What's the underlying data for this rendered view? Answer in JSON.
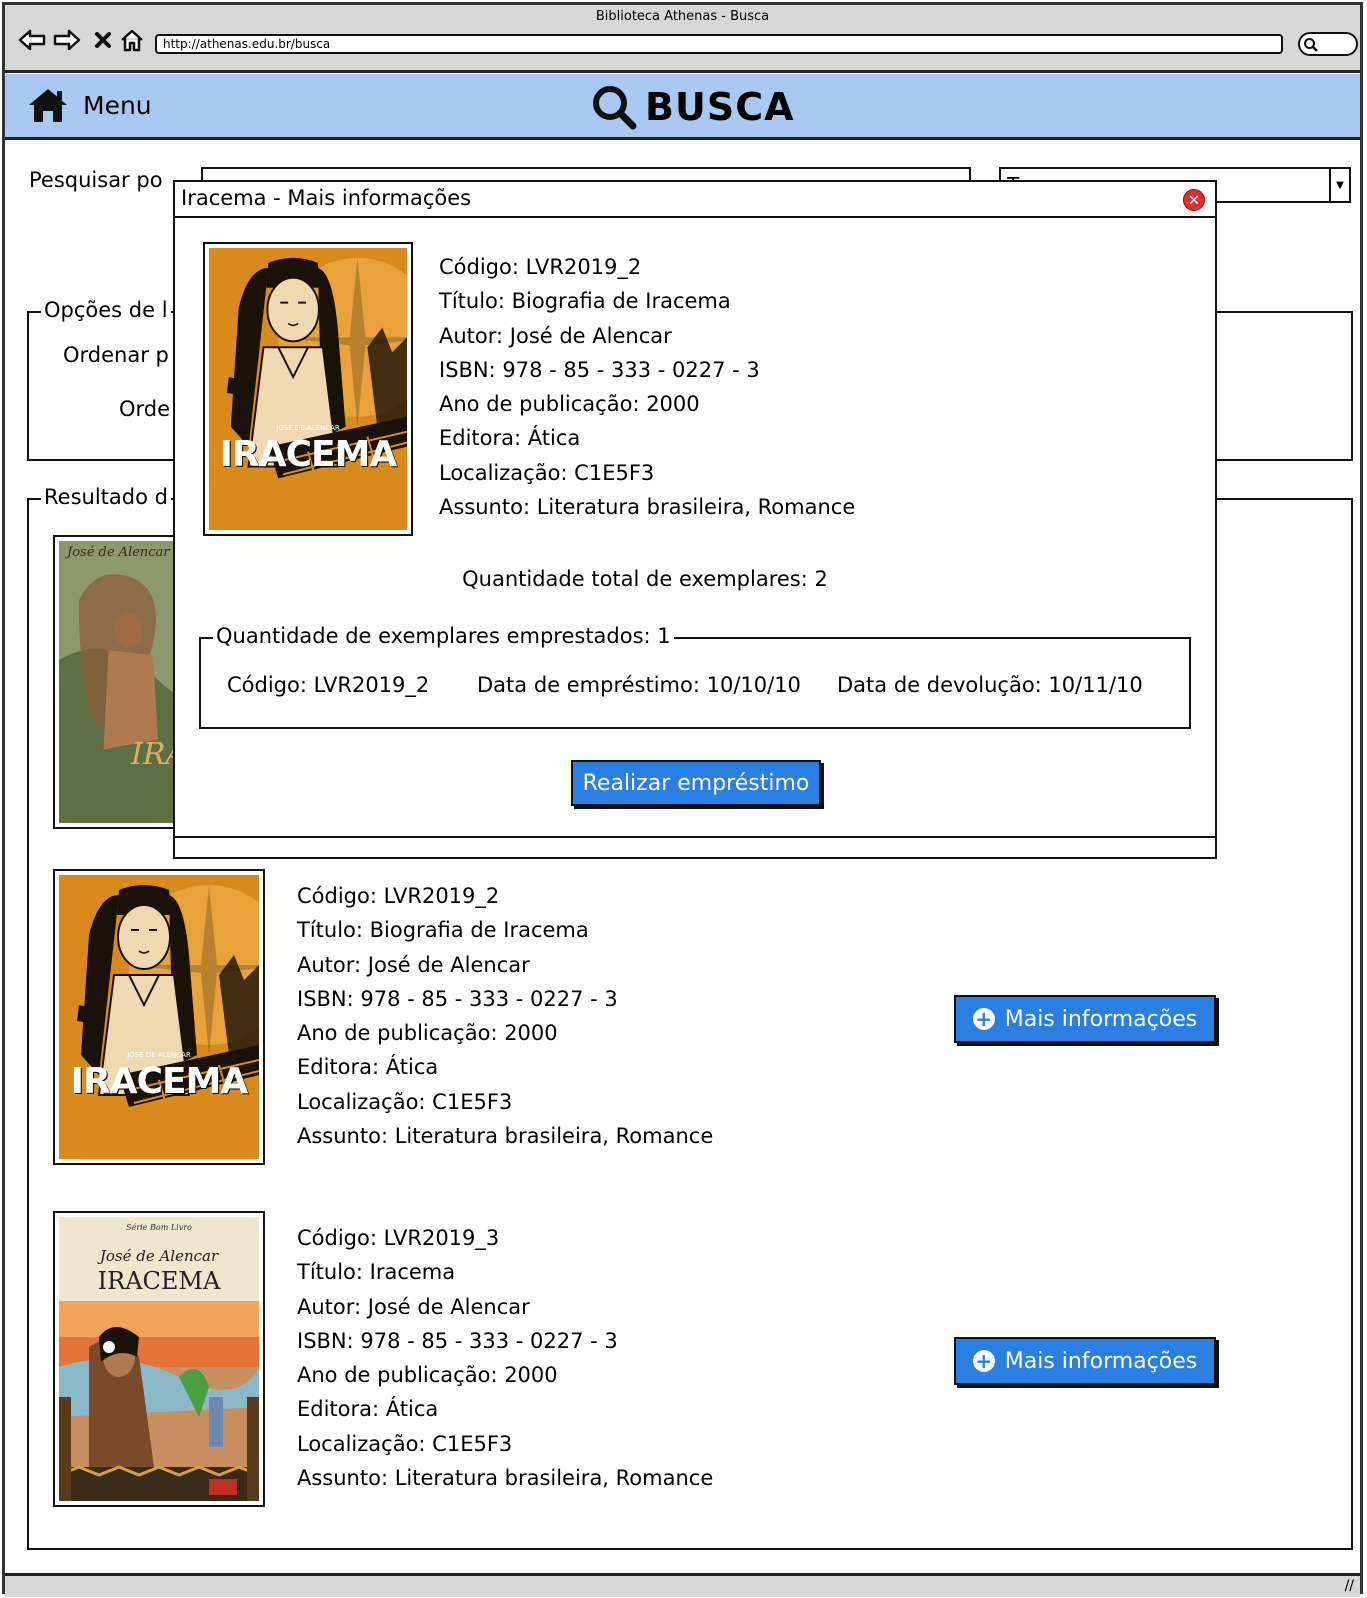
{
  "window": {
    "title": "Biblioteca Athenas - Busca",
    "url": "http://athenas.edu.br/busca"
  },
  "header": {
    "menu_label": "Menu",
    "title": "BUSCA"
  },
  "search": {
    "label": "Pesquisar po",
    "select_value": "T..."
  },
  "options": {
    "legend": "Opções de l",
    "sort_label": "Ordenar p",
    "order_label": "Orde"
  },
  "results_legend": "Resultado d",
  "results": [
    {
      "codigo": "Código: LVR2019_2",
      "titulo": "Título: Biografia de Iracema",
      "autor": "Autor: José de Alencar",
      "isbn": "ISBN: 978 - 85 - 333 - 0227 - 3",
      "ano": "Ano de publicação: 2000",
      "editora": "Editora: Ática",
      "localizacao": "Localização: C1E5F3",
      "assunto": "Assunto: Literatura brasileira, Romance",
      "button": "Mais informações"
    },
    {
      "codigo": "Código: LVR2019_3",
      "titulo": "Título: Iracema",
      "autor": "Autor: José de Alencar",
      "isbn": "ISBN: 978 - 85 - 333 - 0227 - 3",
      "ano": "Ano de publicação: 2000",
      "editora": "Editora: Ática",
      "localizacao": "Localização: C1E5F3",
      "assunto": "Assunto: Literatura brasileira, Romance",
      "button": "Mais informações"
    }
  ],
  "covers": {
    "orange_author": "JOSÉ DE ALENCAR",
    "orange_title": "IRACEMA",
    "classic_series": "Série Bom Livro",
    "classic_author": "José de Alencar",
    "classic_title": "IRACEMA",
    "first_author": "José de Alencar",
    "first_title": "IRA"
  },
  "modal": {
    "title": "Iracema - Mais informações",
    "codigo": "Código: LVR2019_2",
    "titulo": "Título: Biografia de Iracema",
    "autor": "Autor: José de Alencar",
    "isbn": "ISBN: 978 - 85 - 333 - 0227 - 3",
    "ano": "Ano de publicação: 2000",
    "editora": "Editora: Ática",
    "localizacao": "Localização: C1E5F3",
    "assunto": "Assunto: Literatura brasileira, Romance",
    "total": "Quantidade total de exemplares: 2",
    "loans_legend": "Quantidade de exemplares emprestados: 1",
    "loan": {
      "codigo": "Código: LVR2019_2",
      "data_emprestimo": "Data de empréstimo: 10/10/10",
      "data_devolucao": "Data de devolução: 10/11/10"
    },
    "button": "Realizar empréstimo"
  },
  "icons": {
    "back": "arrow-left-icon",
    "forward": "arrow-right-icon",
    "stop": "close-icon",
    "home": "home-icon",
    "search": "search-icon",
    "plus": "plus-circle-icon",
    "close": "close-circle-icon"
  },
  "colors": {
    "header_bg": "#a9c8f2",
    "button_bg": "#2a7fe3",
    "close_red": "#e03030",
    "cover_orange": "#d98a1c"
  }
}
